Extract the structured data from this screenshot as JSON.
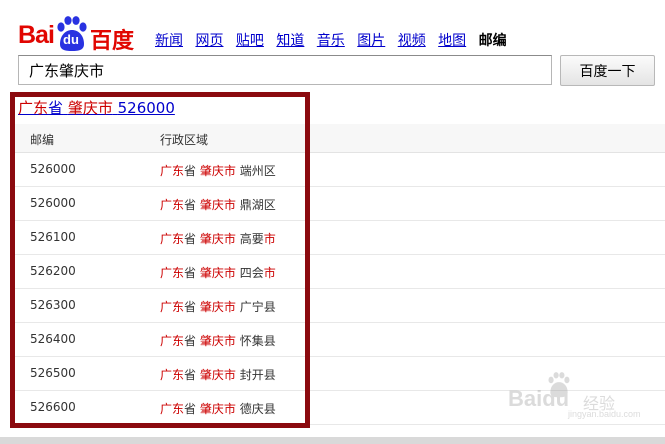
{
  "logo": {
    "text_bai": "Bai",
    "text_du": "du",
    "text_cn": "百度"
  },
  "nav": {
    "items": [
      {
        "label": "新闻"
      },
      {
        "label": "网页"
      },
      {
        "label": "贴吧"
      },
      {
        "label": "知道"
      },
      {
        "label": "音乐"
      },
      {
        "label": "图片"
      },
      {
        "label": "视频"
      },
      {
        "label": "地图"
      }
    ],
    "active": "邮编"
  },
  "search": {
    "value": "广东肇庆市",
    "button": "百度一下"
  },
  "result": {
    "title_prov": "广东",
    "title_prov_suffix": "省",
    "title_city": "肇庆市",
    "title_code": "526000"
  },
  "table": {
    "headers": {
      "code": "邮编",
      "region": "行政区域"
    },
    "rows": [
      {
        "code": "526000",
        "prov": "广东",
        "prov_suffix": "省",
        "city": "肇庆市",
        "district": "端州区"
      },
      {
        "code": "526000",
        "prov": "广东",
        "prov_suffix": "省",
        "city": "肇庆市",
        "district": "鼎湖区"
      },
      {
        "code": "526100",
        "prov": "广东",
        "prov_suffix": "省",
        "city": "肇庆市",
        "district": "高要",
        "district_red": "市"
      },
      {
        "code": "526200",
        "prov": "广东",
        "prov_suffix": "省",
        "city": "肇庆市",
        "district": "四会",
        "district_red": "市"
      },
      {
        "code": "526300",
        "prov": "广东",
        "prov_suffix": "省",
        "city": "肇庆市",
        "district": "广宁县"
      },
      {
        "code": "526400",
        "prov": "广东",
        "prov_suffix": "省",
        "city": "肇庆市",
        "district": "怀集县"
      },
      {
        "code": "526500",
        "prov": "广东",
        "prov_suffix": "省",
        "city": "肇庆市",
        "district": "封开县"
      },
      {
        "code": "526600",
        "prov": "广东",
        "prov_suffix": "省",
        "city": "肇庆市",
        "district": "德庆县"
      }
    ]
  },
  "watermark": {
    "brand": "Baidu",
    "text": "经验",
    "url": "jingyan.baidu.com"
  },
  "colors": {
    "brand_red": "#e10601",
    "highlight_frame": "#8b0a0f",
    "link_blue": "#0000cc",
    "match_red": "#cc0000"
  }
}
